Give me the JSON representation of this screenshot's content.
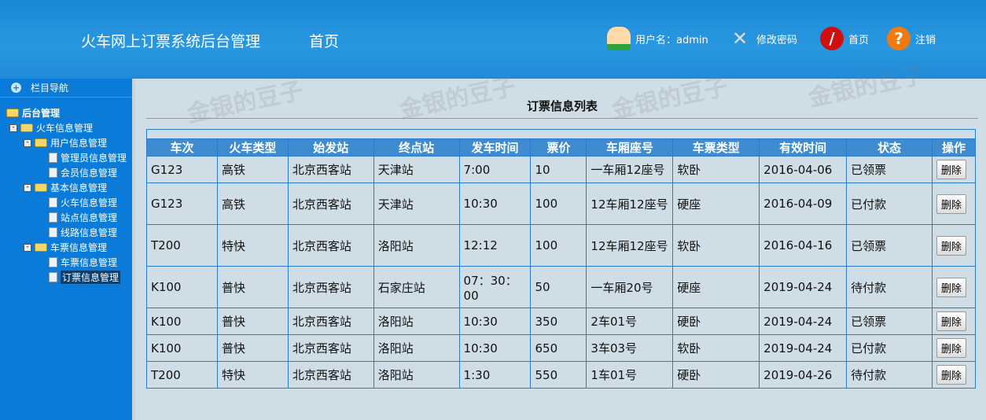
{
  "header": {
    "title": "火车网上订票系统后台管理",
    "home": "首页",
    "user": "用户名：admin",
    "change_password": "修改密码",
    "home_link": "首页",
    "logout": "注销"
  },
  "sidebar": {
    "nav_title": "栏目导航",
    "root": "后台管理",
    "groups": [
      {
        "label": "火车信息管理"
      },
      {
        "label": "用户信息管理",
        "items": [
          "管理员信息管理",
          "会员信息管理"
        ]
      },
      {
        "label": "基本信息管理",
        "items": [
          "火车信息管理",
          "站点信息管理",
          "线路信息管理"
        ]
      },
      {
        "label": "车票信息管理",
        "items": [
          "车票信息管理",
          "订票信息管理"
        ]
      }
    ]
  },
  "main": {
    "title": "订票信息列表",
    "columns": [
      "车次",
      "火车类型",
      "始发站",
      "终点站",
      "发车时间",
      "票价",
      "车厢座号",
      "车票类型",
      "有效时间",
      "状态",
      "操作"
    ],
    "delete_label": "删除",
    "rows": [
      [
        "G123",
        "高铁",
        "北京西客站",
        "天津站",
        "7:00",
        "10",
        "一车厢12座号",
        "软卧",
        "2016-04-06",
        "已领票"
      ],
      [
        "G123",
        "高铁",
        "北京西客站",
        "天津站",
        "10:30",
        "100",
        "12车厢12座号",
        "硬座",
        "2016-04-09",
        "已付款"
      ],
      [
        "T200",
        "特快",
        "北京西客站",
        "洛阳站",
        "12:12",
        "100",
        "12车厢12座号",
        "软卧",
        "2016-04-16",
        "已领票"
      ],
      [
        "K100",
        "普快",
        "北京西客站",
        "石家庄站",
        "07：30：00",
        "50",
        "一车厢20号",
        "硬座",
        "2019-04-24",
        "待付款"
      ],
      [
        "K100",
        "普快",
        "北京西客站",
        "洛阳站",
        "10:30",
        "350",
        "2车01号",
        "硬卧",
        "2019-04-24",
        "已领票"
      ],
      [
        "K100",
        "普快",
        "北京西客站",
        "洛阳站",
        "10:30",
        "650",
        "3车03号",
        "软卧",
        "2019-04-24",
        "已付款"
      ],
      [
        "T200",
        "特快",
        "北京西客站",
        "洛阳站",
        "1:30",
        "550",
        "1车01号",
        "硬卧",
        "2019-04-26",
        "待付款"
      ]
    ]
  },
  "watermark": "金银的豆子"
}
